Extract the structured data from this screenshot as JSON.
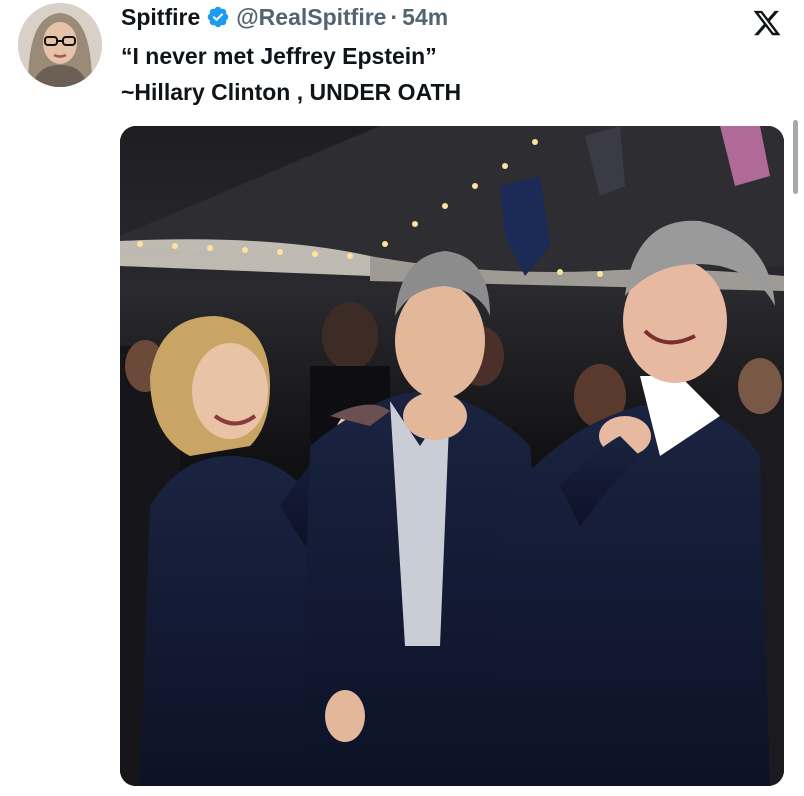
{
  "tweet": {
    "display_name": "Spitfire",
    "handle": "@RealSpitfire",
    "separator": "·",
    "time": "54m",
    "text": "“I never met Jeffrey Epstein”\n~Hillary Clinton , UNDER OATH",
    "verified": true
  },
  "icons": {
    "verified": "verified-badge-icon",
    "platform": "x-logo-icon"
  },
  "colors": {
    "verified_blue": "#1d9bf0",
    "secondary_text": "#536471",
    "primary_text": "#0f1419"
  }
}
